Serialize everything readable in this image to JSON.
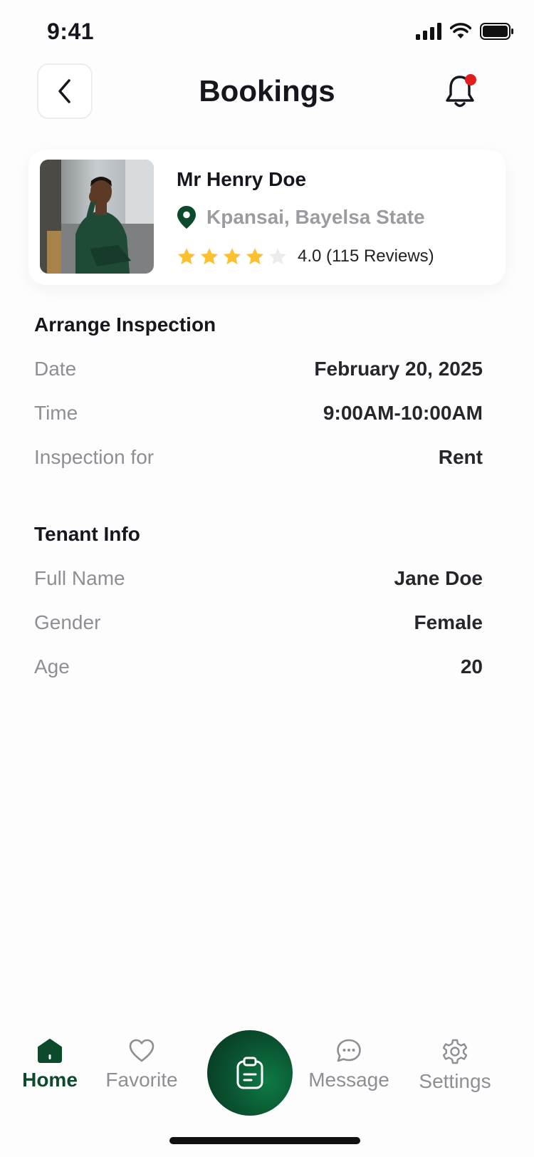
{
  "status": {
    "time": "9:41"
  },
  "header": {
    "title": "Bookings"
  },
  "agent": {
    "name": "Mr Henry Doe",
    "location": "Kpansai, Bayelsa State",
    "rating": 4.0,
    "rating_text": "4.0 (115 Reviews)"
  },
  "inspection": {
    "title": "Arrange Inspection",
    "rows": [
      {
        "label": "Date",
        "value": "February 20, 2025"
      },
      {
        "label": "Time",
        "value": "9:00AM-10:00AM"
      },
      {
        "label": "Inspection for",
        "value": "Rent"
      }
    ]
  },
  "tenant": {
    "title": "Tenant Info",
    "rows": [
      {
        "label": "Full Name",
        "value": "Jane Doe"
      },
      {
        "label": "Gender",
        "value": "Female"
      },
      {
        "label": "Age",
        "value": "20"
      }
    ]
  },
  "tabbar": {
    "home": "Home",
    "favorite": "Favorite",
    "message": "Message",
    "settings": "Settings"
  },
  "icons": {
    "back": "chevron-left-icon",
    "notification": "bell-icon",
    "location": "map-pin-icon",
    "star": "star-icon",
    "center": "clipboard-icon"
  },
  "colors": {
    "brand": "#0a4f2e",
    "star": "#fbc02d",
    "badge": "#e11d1d"
  }
}
